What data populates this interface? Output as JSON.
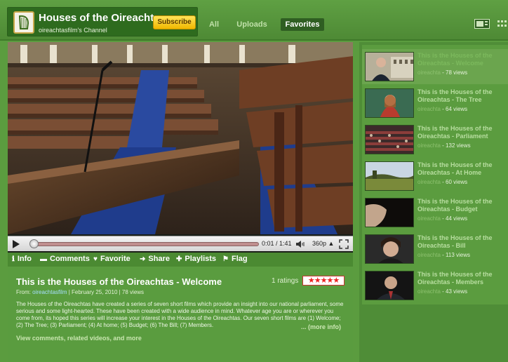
{
  "header": {
    "channel_title": "Houses of the Oireachtas",
    "channel_subtitle": "oireachtasfilm's Channel",
    "subscribe_label": "Subscribe",
    "tabs": [
      {
        "label": "All"
      },
      {
        "label": "Uploads"
      },
      {
        "label": "Favorites",
        "active": true
      }
    ]
  },
  "player": {
    "time": "0:01 / 1:41",
    "quality": "360p",
    "progress_fraction": 0.01
  },
  "actions": [
    {
      "icon": "info-icon",
      "label": "Info"
    },
    {
      "icon": "comment-icon",
      "label": "Comments"
    },
    {
      "icon": "heart-icon",
      "label": "Favorite"
    },
    {
      "icon": "share-arrow-icon",
      "label": "Share"
    },
    {
      "icon": "plus-icon",
      "label": "Playlists"
    },
    {
      "icon": "flag-icon",
      "label": "Flag"
    }
  ],
  "info": {
    "title": "This is the Houses of the Oireachtas - Welcome",
    "ratings": "1 ratings",
    "stars": 5,
    "from_label": "From:",
    "from_channel": "oireachtasfilm",
    "date_views": "| February 25, 2010 | 78 views",
    "description": "The Houses of the Oireachtas have created a series of seven short films which provide an insight into our national parliament, some serious and some light-hearted. These have been created with a wide audience in mind. Whatever age you are or wherever you come from, its hoped this series will increase your interest in the Houses of the Oireachtas. Our seven short films are (1) Welcome; (2) The Tree; (3) Parliament; (4) At home; (5) Budget; (6) The Bill; (7) Members.",
    "more_info": "... (more info)",
    "view_comments": "View comments, related videos, and more"
  },
  "sidebar": {
    "items": [
      {
        "title": "This is the Houses of the Oireachtas - Welcome",
        "channel": "oireachta",
        "views": "- 78 views",
        "selected": true,
        "thumb": "man-building"
      },
      {
        "title": "This is the Houses of the Oireachtas - The Tree",
        "channel": "oireachta",
        "views": "- 64 views",
        "thumb": "girl"
      },
      {
        "title": "This is the Houses of the Oireachtas - Parliament",
        "channel": "oireachta",
        "views": "- 132 views",
        "thumb": "chamber"
      },
      {
        "title": "This is the Houses of the Oireachtas - At Home",
        "channel": "oireachta",
        "views": "- 60 views",
        "thumb": "field"
      },
      {
        "title": "This is the Houses of the Oireachtas - Budget",
        "channel": "oireachta",
        "views": "- 44 views",
        "thumb": "face-dark"
      },
      {
        "title": "This is the Houses of the Oireachtas - Bill",
        "channel": "oireachta",
        "views": "- 113 views",
        "thumb": "woman"
      },
      {
        "title": "This is the Houses of the Oireachtas - Members",
        "channel": "oireachta",
        "views": "- 43 views",
        "thumb": "man-suit"
      }
    ]
  }
}
